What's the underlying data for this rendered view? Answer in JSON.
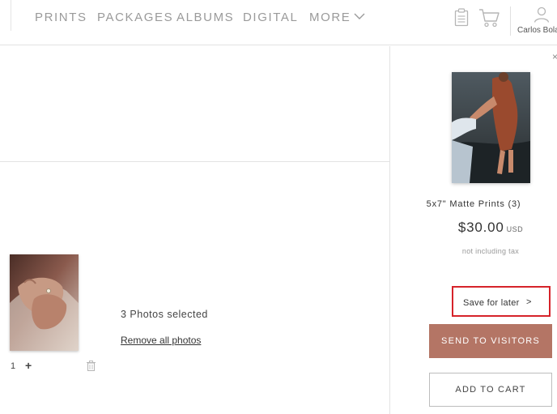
{
  "nav": {
    "items": [
      {
        "label": "PRINTS"
      },
      {
        "label": "PACKAGES"
      },
      {
        "label": "ALBUMS"
      },
      {
        "label": "DIGITAL"
      },
      {
        "label": "MORE"
      }
    ],
    "account_name": "Carlos Bola",
    "icons": [
      "clipboard-icon",
      "cart-icon",
      "user-icon",
      "chevron-down-icon"
    ]
  },
  "selection": {
    "quantity": "1",
    "plus": "+",
    "summary": "3 Photos selected",
    "remove_all": "Remove all photos"
  },
  "product": {
    "title": "5x7\" Matte Prints (3)",
    "price": "$30.00",
    "currency": "USD",
    "tax_note": "not including tax",
    "close": "×"
  },
  "actions": {
    "save_later": "Save for later",
    "save_later_chevron": ">",
    "send_to_visitors": "SEND TO VISITORS",
    "add_to_cart": "ADD TO CART"
  },
  "colors": {
    "accent_button": "#b47565",
    "highlight_border": "#d6232a"
  }
}
